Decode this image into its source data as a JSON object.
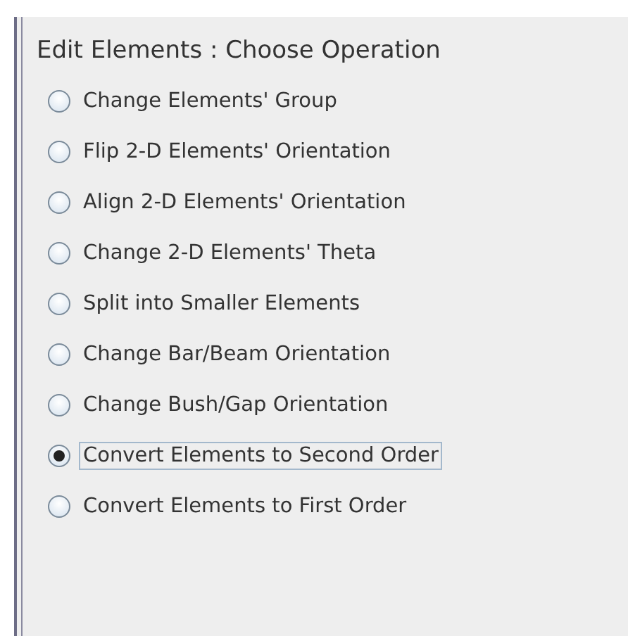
{
  "panel": {
    "title": "Edit Elements : Choose Operation"
  },
  "options": [
    {
      "label": "Change Elements' Group",
      "selected": false
    },
    {
      "label": "Flip 2-D Elements' Orientation",
      "selected": false
    },
    {
      "label": "Align 2-D Elements' Orientation",
      "selected": false
    },
    {
      "label": "Change 2-D Elements' Theta",
      "selected": false
    },
    {
      "label": "Split into Smaller Elements",
      "selected": false
    },
    {
      "label": "Change Bar/Beam Orientation",
      "selected": false
    },
    {
      "label": "Change Bush/Gap Orientation",
      "selected": false
    },
    {
      "label": "Convert Elements to Second Order",
      "selected": true
    },
    {
      "label": "Convert Elements to First Order",
      "selected": false
    }
  ]
}
